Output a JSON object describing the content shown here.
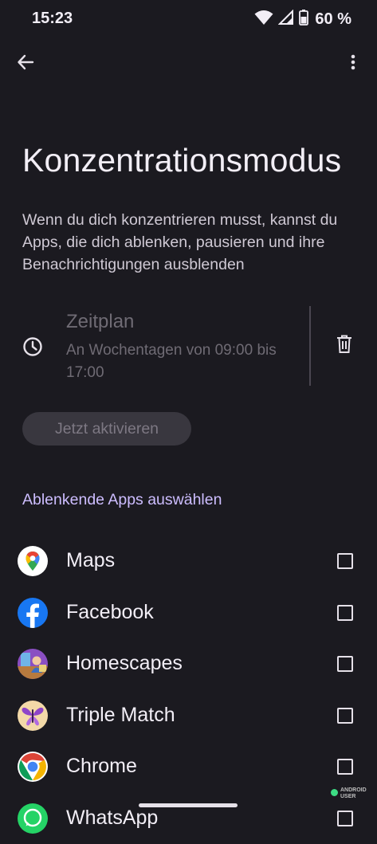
{
  "status_bar": {
    "time": "15:23",
    "battery": "60 %",
    "icons": [
      "wifi-icon",
      "cell-signal-icon",
      "battery-icon"
    ]
  },
  "app_bar": {
    "back_icon": "arrow-back-icon",
    "more_icon": "more-vert-icon"
  },
  "page": {
    "title": "Konzentrationsmodus",
    "description": "Wenn du dich konzentrieren musst, kannst du Apps, die dich ablenken, pausieren und ihre Benachrichtigungen ausblenden"
  },
  "schedule": {
    "icon": "clock-icon",
    "title": "Zeitplan",
    "subtitle": "An Wochentagen von 09:00 bis 17:00",
    "delete_icon": "delete-icon"
  },
  "activate_button": "Jetzt aktivieren",
  "section_header": "Ablenkende Apps auswählen",
  "apps": [
    {
      "name": "Maps",
      "icon": "maps-icon",
      "checked": false
    },
    {
      "name": "Facebook",
      "icon": "facebook-icon",
      "checked": false
    },
    {
      "name": "Homescapes",
      "icon": "homescapes-icon",
      "checked": false
    },
    {
      "name": "Triple Match",
      "icon": "triple-match-icon",
      "checked": false
    },
    {
      "name": "Chrome",
      "icon": "chrome-icon",
      "checked": false
    },
    {
      "name": "WhatsApp",
      "icon": "whatsapp-icon",
      "checked": false
    }
  ],
  "watermark": {
    "line1": "ANDROID",
    "line2": "USER"
  },
  "colors": {
    "background": "#1b1a20",
    "accent": "#cdbdff",
    "muted_text": "#6f6b74",
    "button_bg": "#39373f"
  }
}
